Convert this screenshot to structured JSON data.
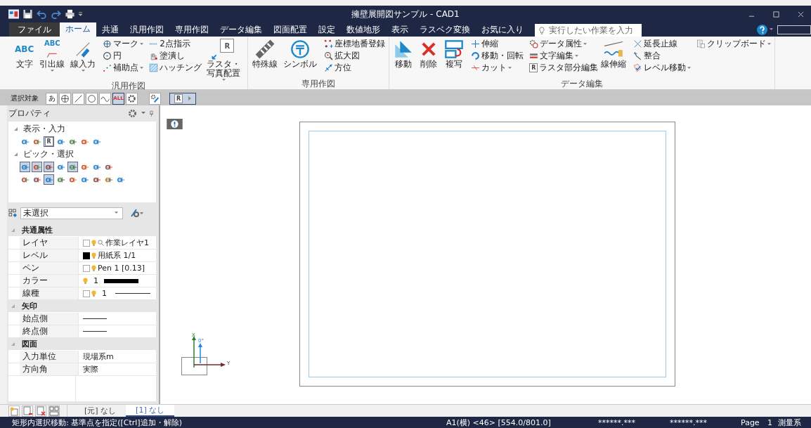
{
  "window": {
    "title": "擁壁展開図サンプル - CAD1"
  },
  "tabs": [
    {
      "label": "ファイル",
      "kind": "file",
      "selected": false
    },
    {
      "label": "ホーム",
      "kind": "tab",
      "selected": true
    },
    {
      "label": "共通",
      "kind": "tab",
      "selected": false
    },
    {
      "label": "汎用作図",
      "kind": "tab",
      "selected": false
    },
    {
      "label": "専用作図",
      "kind": "tab",
      "selected": false
    },
    {
      "label": "データ編集",
      "kind": "tab",
      "selected": false
    },
    {
      "label": "図面配置",
      "kind": "tab",
      "selected": false
    },
    {
      "label": "設定",
      "kind": "tab",
      "selected": false
    },
    {
      "label": "数値地形",
      "kind": "tab",
      "selected": false
    },
    {
      "label": "表示",
      "kind": "tab",
      "selected": false
    },
    {
      "label": "ラスベク変換",
      "kind": "tab",
      "selected": false
    },
    {
      "label": "お気に入り",
      "kind": "tab",
      "selected": false
    }
  ],
  "search": {
    "placeholder": "実行したい作業を入力"
  },
  "ribbon": [
    {
      "label": "汎用作図",
      "columns": [
        {
          "kind": "large",
          "items": [
            {
              "label": "文字",
              "icon_text": "ABC",
              "dropdown": false
            }
          ]
        },
        {
          "kind": "large",
          "items": [
            {
              "label": "引出線",
              "icon_text": "ABC",
              "dropdown": true
            }
          ]
        },
        {
          "kind": "large",
          "items": [
            {
              "label": "線入力",
              "dropdown": true
            }
          ]
        },
        {
          "kind": "small",
          "items": [
            {
              "label": "マーク",
              "dropdown": true
            },
            {
              "label": "円",
              "dropdown": false
            },
            {
              "label": "補助点",
              "dropdown": true
            }
          ]
        },
        {
          "kind": "small",
          "items": [
            {
              "label": "2点指示",
              "dropdown": false
            },
            {
              "label": "塗潰し",
              "dropdown": false
            },
            {
              "label": "ハッチング",
              "dropdown": false
            }
          ]
        },
        {
          "kind": "large",
          "items": [
            {
              "label": "ラスタ・写真配置",
              "icon_text": "R",
              "dropdown": true
            }
          ]
        }
      ]
    },
    {
      "label": "専用作図",
      "columns": [
        {
          "kind": "large",
          "items": [
            {
              "label": "特殊線",
              "dropdown": false
            }
          ]
        },
        {
          "kind": "large",
          "items": [
            {
              "label": "シンボル",
              "dropdown": false
            }
          ]
        },
        {
          "kind": "small",
          "items": [
            {
              "label": "座標地番登録",
              "dropdown": false
            },
            {
              "label": "拡大図",
              "dropdown": false
            },
            {
              "label": "方位",
              "dropdown": false
            }
          ]
        }
      ]
    },
    {
      "label": "データ編集",
      "columns": [
        {
          "kind": "large",
          "items": [
            {
              "label": "移動",
              "dropdown": false
            }
          ]
        },
        {
          "kind": "large",
          "items": [
            {
              "label": "削除",
              "dropdown": false
            }
          ]
        },
        {
          "kind": "large",
          "items": [
            {
              "label": "複写",
              "dropdown": false
            }
          ]
        },
        {
          "kind": "small",
          "items": [
            {
              "label": "伸縮",
              "dropdown": false
            },
            {
              "label": "移動・回転",
              "dropdown": false
            },
            {
              "label": "カット",
              "dropdown": true
            }
          ]
        },
        {
          "kind": "small",
          "items": [
            {
              "label": "データ属性",
              "dropdown": true
            },
            {
              "label": "文字編集",
              "dropdown": true
            },
            {
              "label": "ラスタ部分編集",
              "icon_text": "R",
              "dropdown": false
            }
          ]
        },
        {
          "kind": "large",
          "items": [
            {
              "label": "線伸縮",
              "dropdown": false
            }
          ]
        },
        {
          "kind": "small",
          "items": [
            {
              "label": "延長止線",
              "dropdown": false
            },
            {
              "label": "整合",
              "dropdown": false
            },
            {
              "label": "レベル移動",
              "dropdown": true
            }
          ]
        },
        {
          "kind": "small",
          "items": [
            {
              "label": "クリップボード",
              "dropdown": true
            }
          ]
        }
      ]
    }
  ],
  "selection_toolbar": {
    "label": "選択対象",
    "buttons": [
      {
        "kind": "text",
        "text": "あ",
        "selected": false
      },
      {
        "kind": "icon",
        "selected": false
      },
      {
        "kind": "icon",
        "selected": false
      },
      {
        "kind": "icon",
        "selected": false
      },
      {
        "kind": "icon",
        "selected": false
      },
      {
        "kind": "text",
        "text": "ALL",
        "selected": true
      },
      {
        "kind": "icon",
        "selected": false
      }
    ],
    "extra_buttons": [
      {
        "kind": "icon",
        "selected": false
      },
      {
        "kind": "raster",
        "text": "R",
        "selected": true
      }
    ]
  },
  "properties": {
    "title": "プロパティ",
    "sections": [
      {
        "label": "表示・入力",
        "expanded": true,
        "rows": [
          [
            {
              "selected": false
            },
            {
              "selected": false
            },
            {
              "selected": true,
              "text": "R"
            },
            {
              "selected": false
            },
            {
              "selected": false
            },
            {
              "selected": false
            },
            {
              "selected": false
            }
          ]
        ]
      },
      {
        "label": "ピック・選択",
        "expanded": true,
        "rows": [
          [
            {
              "selected": true
            },
            {
              "selected": true
            },
            {
              "selected": true
            },
            {
              "selected": false
            },
            {
              "selected": true
            },
            {
              "selected": false
            },
            {
              "selected": false
            },
            {
              "selected": false
            }
          ],
          [
            {
              "selected": false
            },
            {
              "selected": false
            },
            {
              "selected": true
            },
            {
              "selected": false
            },
            {
              "selected": false
            },
            {
              "selected": false
            },
            {
              "selected": false
            },
            {
              "selected": false
            },
            {
              "selected": false
            }
          ]
        ]
      }
    ],
    "selector": {
      "value": "未選択"
    },
    "groups": [
      {
        "label": "共通属性",
        "expanded": true,
        "rows": [
          {
            "label": "レイヤ",
            "kind": "text",
            "checked": false,
            "bulb": true,
            "search": true,
            "value": "作業レイヤ1"
          },
          {
            "label": "レベル",
            "kind": "text",
            "checked": true,
            "bulb": true,
            "search": false,
            "value": "用紙系 1/1"
          },
          {
            "label": "ペン",
            "kind": "text",
            "checked": false,
            "bulb": true,
            "search": false,
            "value": "Pen 1 [0.13]"
          },
          {
            "label": "カラー",
            "kind": "color",
            "bulb": true,
            "search": false,
            "value": "1",
            "color": "#000000"
          },
          {
            "label": "線種",
            "kind": "line",
            "checked": false,
            "bulb": true,
            "search": false,
            "value": "1"
          }
        ]
      },
      {
        "label": "矢印",
        "expanded": true,
        "rows": [
          {
            "label": "始点側",
            "kind": "line",
            "bulb": false,
            "search": false
          },
          {
            "label": "終点側",
            "kind": "line",
            "bulb": false,
            "search": false
          }
        ]
      },
      {
        "label": "図面",
        "expanded": true,
        "rows": [
          {
            "label": "入力単位",
            "kind": "text",
            "bulb": false,
            "search": false,
            "value": "現場系m"
          },
          {
            "label": "方向角",
            "kind": "text",
            "bulb": false,
            "search": false,
            "value": "実際"
          }
        ]
      }
    ]
  },
  "bottom_tabs": [
    {
      "label": "[元] なし",
      "selected": false
    },
    {
      "label": "[1] なし",
      "selected": true
    }
  ],
  "axis": {
    "x": "X",
    "y": "Y",
    "angle": "0°"
  },
  "status_bar": {
    "message": "矩形内選択移動: 基準点を指定([Ctrl]追加・解除)",
    "sheet": "A1(横) <46> [554.0/801.0]",
    "coord_1": "******.***",
    "coord_2": "******.***",
    "page_label": "Page",
    "page": "1",
    "system": "測量系"
  }
}
